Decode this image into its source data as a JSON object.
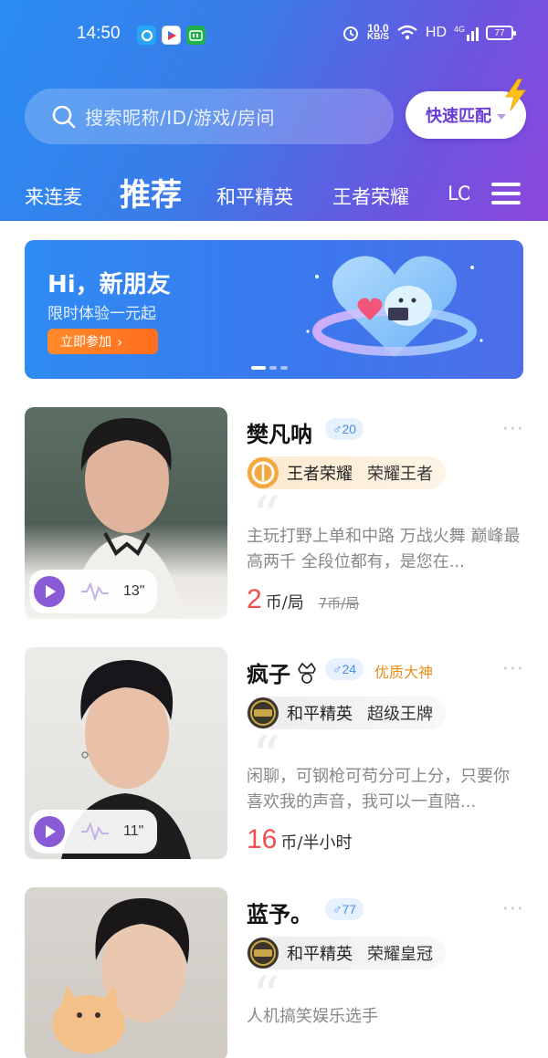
{
  "status_bar": {
    "time": "14:50",
    "apps": [
      {
        "icon": "app-browser-icon",
        "label": "",
        "color": "#28a6f5"
      },
      {
        "icon": "app-youku-icon",
        "label": "",
        "color": "#e8334a"
      },
      {
        "icon": "app-iqiyi-icon",
        "label": "",
        "color": "#1fb24b"
      }
    ],
    "speed_value": "10.0",
    "speed_unit": "KB/S",
    "hd": "HD",
    "network": "4G",
    "battery": "77"
  },
  "search": {
    "placeholder": "搜索昵称/ID/游戏/房间"
  },
  "quick_match": {
    "label": "快速匹配"
  },
  "tabs": [
    {
      "label": "来连麦",
      "active": false
    },
    {
      "label": "推荐",
      "active": true
    },
    {
      "label": "和平精英",
      "active": false
    },
    {
      "label": "王者荣耀",
      "active": false
    },
    {
      "label": "LO",
      "active": false
    }
  ],
  "banner": {
    "title": "Hi，新朋友",
    "subtitle": "限时体验一元起",
    "button": "立即参加",
    "pages": 3,
    "current_page": 1
  },
  "players": [
    {
      "name": "樊凡呐",
      "gender_age": "♂20",
      "quality_tag": "",
      "game": "王者荣耀",
      "game_icon": "honor-of-kings-icon",
      "rank": "荣耀王者",
      "description": "主玩打野上单和中路 万战火舞 巅峰最高两千 全段位都有，是您在...",
      "price": "2",
      "price_unit": "币/局",
      "original_price": "7币/局",
      "voice_duration": "13\""
    },
    {
      "name": "疯子",
      "gender_age": "♂24",
      "quality_tag": "优质大神",
      "game": "和平精英",
      "game_icon": "peace-elite-icon",
      "rank": "超级王牌",
      "description": "闲聊，可钢枪可苟分可上分，只要你喜欢我的声音，我可以一直陪...",
      "price": "16",
      "price_unit": "币/半小时",
      "original_price": "",
      "voice_duration": "11\""
    },
    {
      "name": "蓝予。",
      "gender_age": "♂77",
      "quality_tag": "",
      "game": "和平精英",
      "game_icon": "peace-elite-icon",
      "rank": "荣耀皇冠",
      "description": "人机搞笑娱乐选手",
      "price": "",
      "price_unit": "",
      "original_price": "",
      "voice_duration": ""
    }
  ],
  "colors": {
    "header_start": "#2a8df2",
    "header_end": "#8d47dc",
    "accent_purple": "#6a3cd9",
    "price_red": "#f0504e",
    "quality_orange": "#e8901f"
  }
}
